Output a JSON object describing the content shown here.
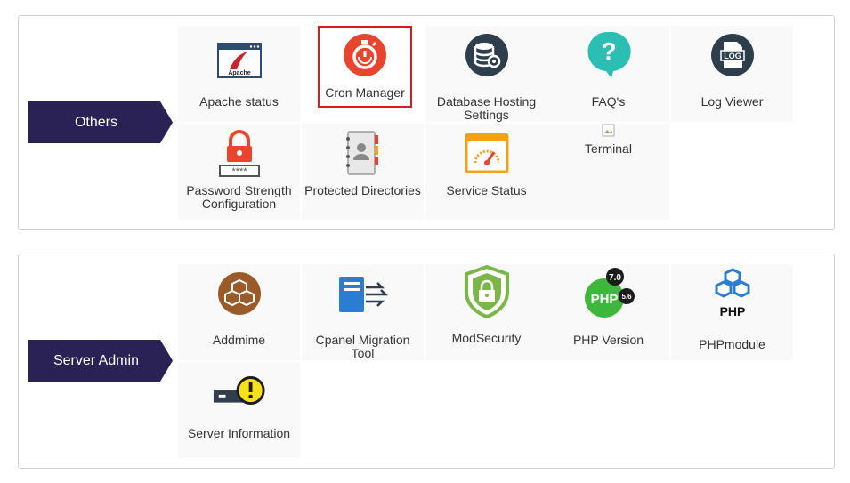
{
  "sections": [
    {
      "title": "Others",
      "items": [
        {
          "label": "Apache status",
          "icon": "apache-icon"
        },
        {
          "label": "Cron Manager",
          "icon": "stopwatch-icon",
          "selected": true
        },
        {
          "label": "Database Hosting Settings",
          "icon": "database-gear-icon"
        },
        {
          "label": "FAQ's",
          "icon": "question-bubble-icon"
        },
        {
          "label": "Log Viewer",
          "icon": "log-file-icon"
        },
        {
          "label": "Password Strength Configuration",
          "icon": "padlock-password-icon"
        },
        {
          "label": "Protected Directories",
          "icon": "address-book-icon"
        },
        {
          "label": "Service Status",
          "icon": "speedometer-window-icon"
        },
        {
          "label": "Terminal",
          "icon": "broken-image-icon"
        }
      ]
    },
    {
      "title": "Server Admin",
      "items": [
        {
          "label": "Addmime",
          "icon": "cubes-icon"
        },
        {
          "label": "Cpanel Migration Tool",
          "icon": "server-transfer-icon"
        },
        {
          "label": "ModSecurity",
          "icon": "shield-lock-icon"
        },
        {
          "label": "PHP Version",
          "icon": "php-version-icon",
          "badges": [
            "7.0",
            "5.6"
          ],
          "badge_text": "PHP"
        },
        {
          "label": "PHPmodule",
          "icon": "php-module-icon",
          "badge_text": "PHP"
        },
        {
          "label": "Server Information",
          "icon": "server-warning-icon"
        }
      ]
    }
  ],
  "colors": {
    "ribbon": "#2a2255",
    "highlight": "#d71c1c",
    "cron": "#e8442e",
    "modsecurity": "#7ab648",
    "php": "#3db83c"
  }
}
